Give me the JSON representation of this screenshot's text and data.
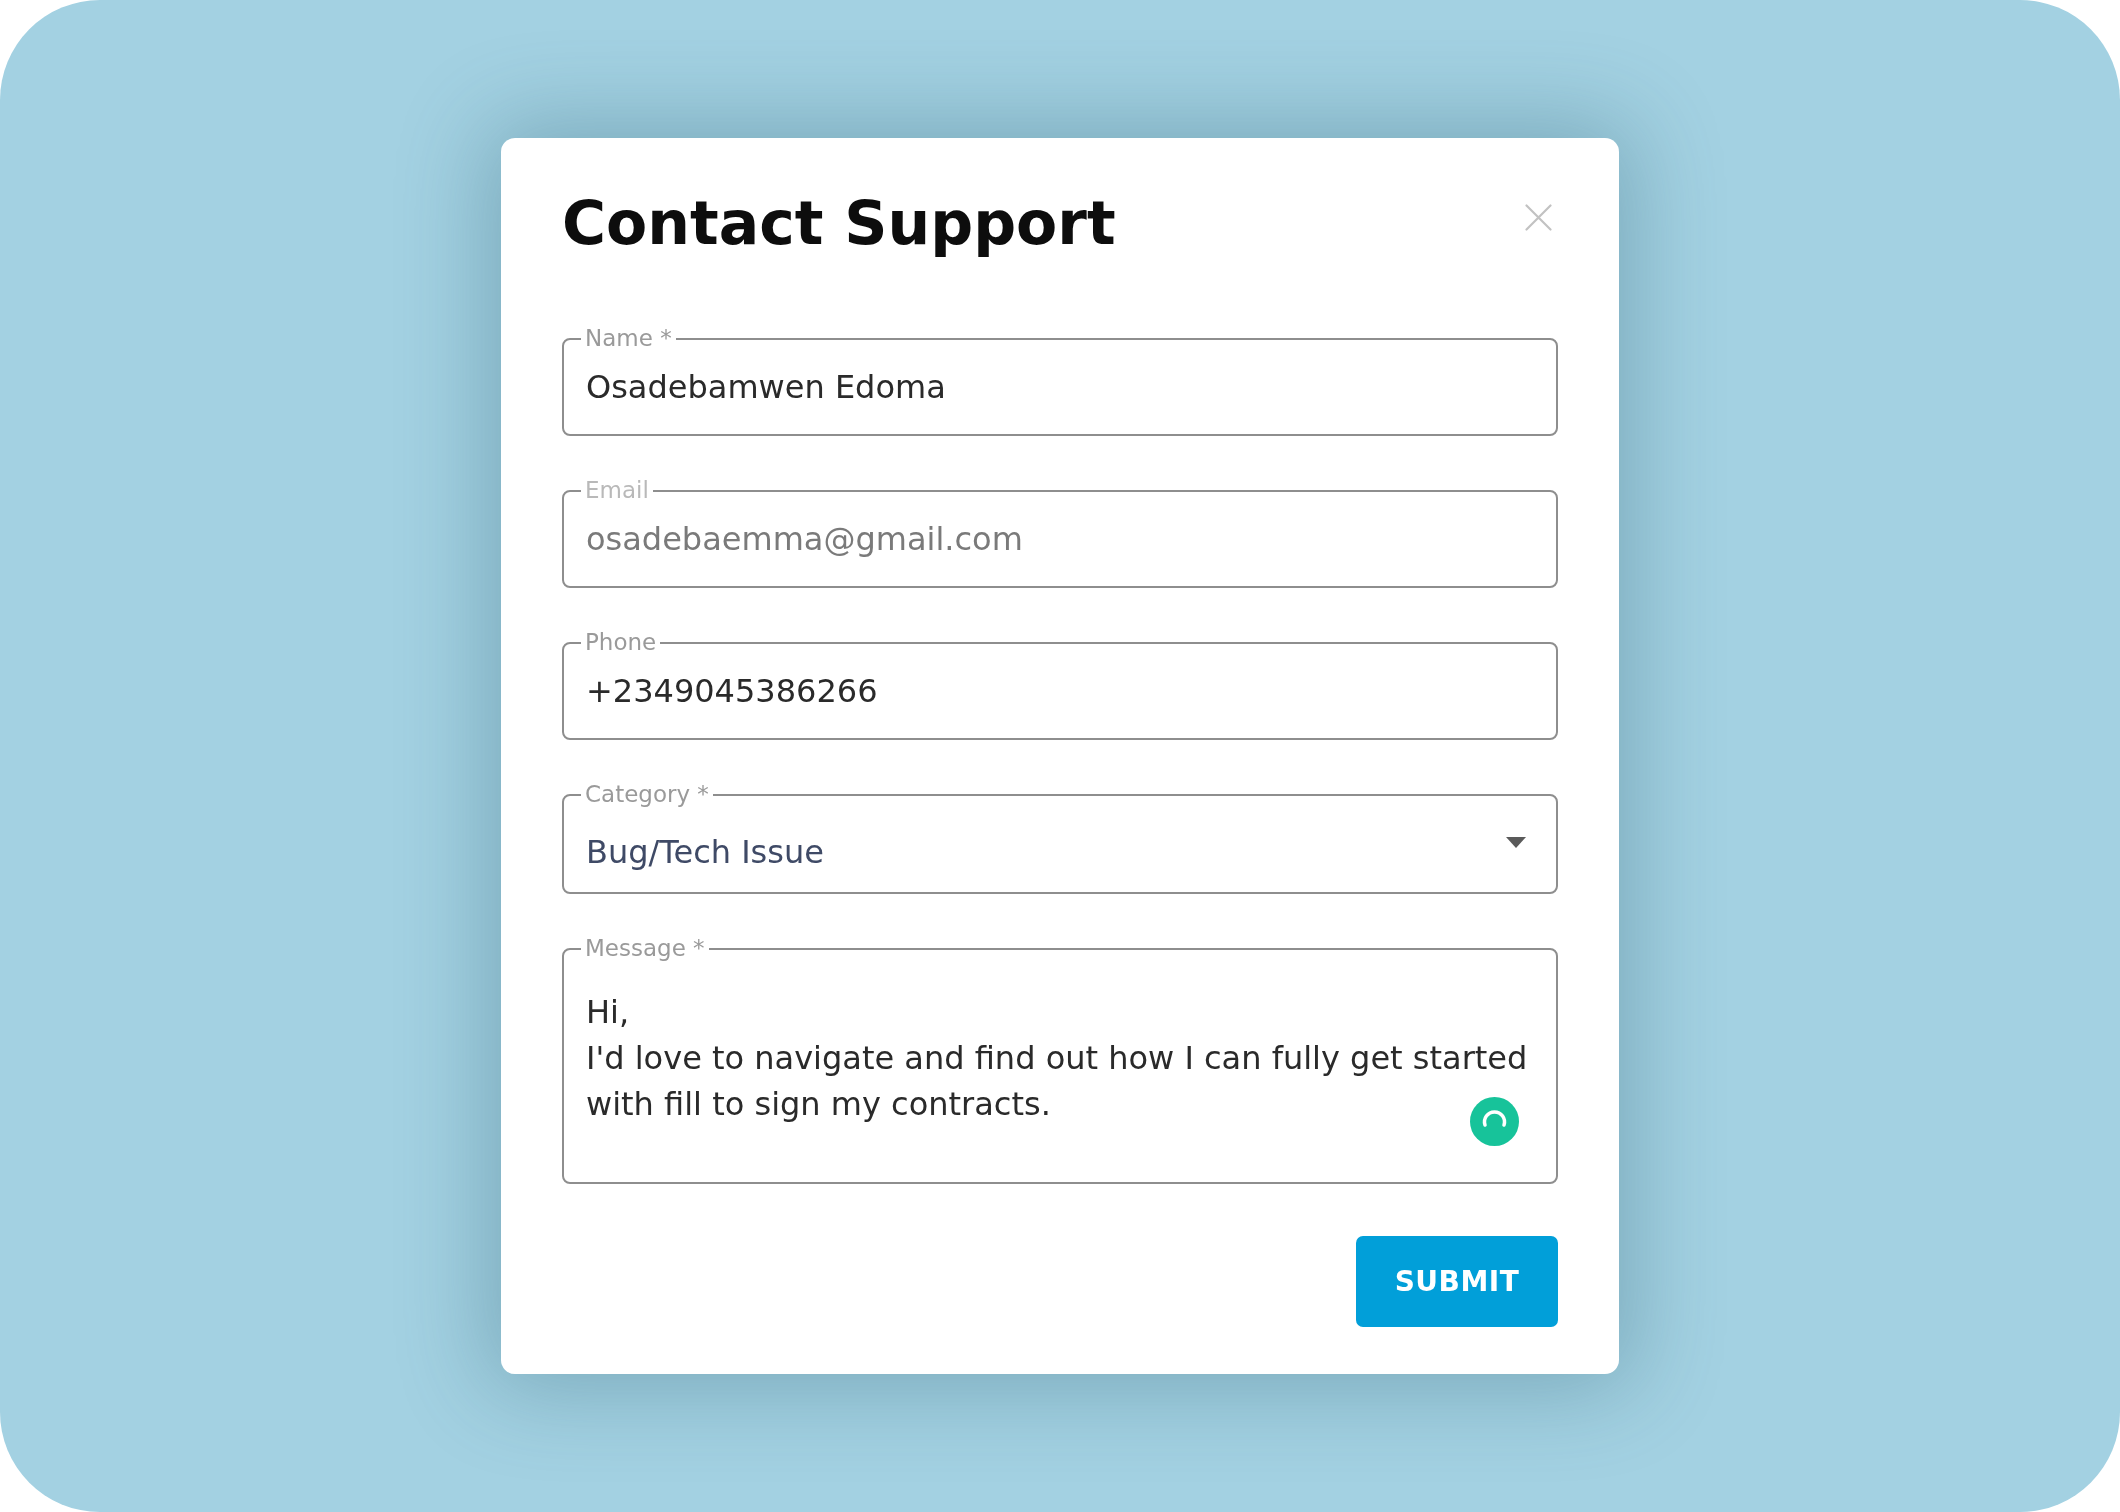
{
  "dialog": {
    "title": "Contact Support",
    "fields": [
      {
        "kind": "text",
        "label": "Name *",
        "value": "Osadebamwen Edoma",
        "disabled": false
      },
      {
        "kind": "text",
        "label": "Email",
        "value": "osadebaemma@gmail.com",
        "disabled": true
      },
      {
        "kind": "text",
        "label": "Phone",
        "value": "+2349045386266",
        "disabled": false
      },
      {
        "kind": "select",
        "label": "Category *",
        "value": "Bug/Tech Issue",
        "disabled": false
      },
      {
        "kind": "textarea",
        "label": "Message *",
        "value": "Hi,\nI'd love to navigate and find out how I can fully get started\nwith fill to sign my contracts.",
        "disabled": false
      }
    ],
    "submit": "SUBMIT"
  }
}
